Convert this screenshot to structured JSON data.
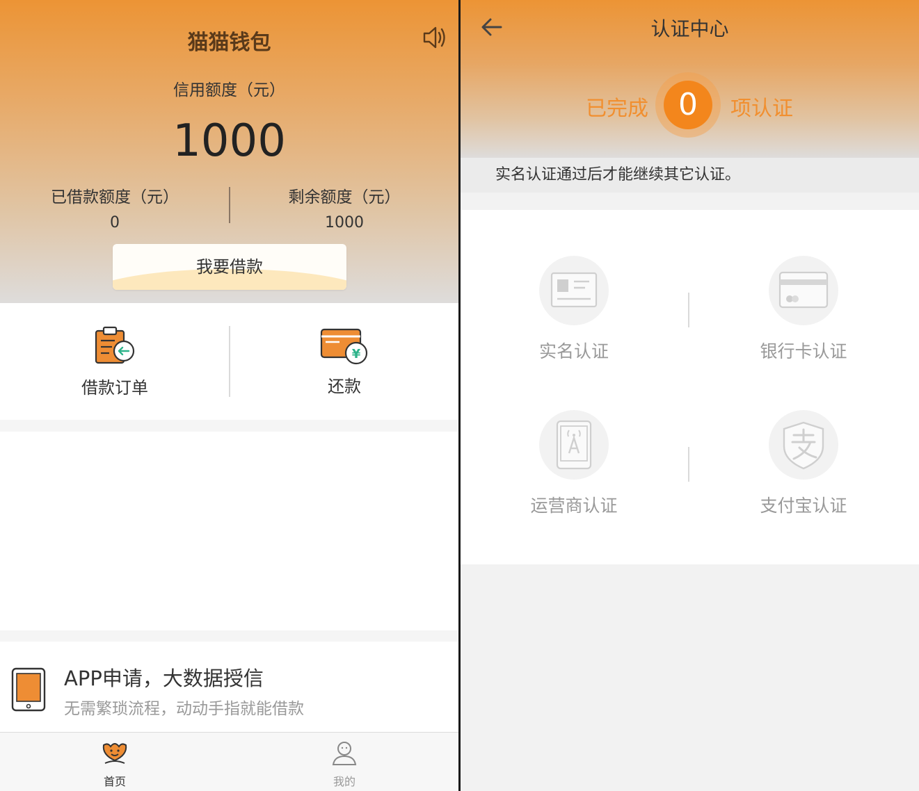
{
  "home": {
    "app_title": "猫猫钱包",
    "credit_label": "信用额度（元）",
    "credit_value": "1000",
    "borrowed_label": "已借款额度（元）",
    "borrowed_value": "0",
    "remaining_label": "剩余额度（元）",
    "remaining_value": "1000",
    "borrow_button": "我要借款",
    "quick_actions": [
      {
        "label": "借款订单",
        "icon": "loan-order-icon"
      },
      {
        "label": "还款",
        "icon": "repay-card-icon"
      }
    ],
    "promo": {
      "title": "APP申请，大数据授信",
      "subtitle": "无需繁琐流程，动动手指就能借款",
      "icon": "tablet-icon"
    },
    "tabs": [
      {
        "label": "首页",
        "icon": "home-flower-icon",
        "active": true
      },
      {
        "label": "我的",
        "icon": "person-icon",
        "active": false
      }
    ]
  },
  "auth": {
    "title": "认证中心",
    "done_prefix": "已完成",
    "done_count": "0",
    "done_suffix": "项认证",
    "notice": "实名认证通过后才能继续其它认证。",
    "items": [
      {
        "label": "实名认证",
        "icon": "id-card-icon"
      },
      {
        "label": "银行卡认证",
        "icon": "bank-card-icon"
      },
      {
        "label": "运营商认证",
        "icon": "carrier-phone-icon"
      },
      {
        "label": "支付宝认证",
        "icon": "alipay-shield-icon"
      }
    ]
  },
  "colors": {
    "brand_orange": "#f3861c",
    "header_gradient_top": "#ec9435",
    "muted_text": "#999999",
    "accent_text": "#f18f2f"
  }
}
